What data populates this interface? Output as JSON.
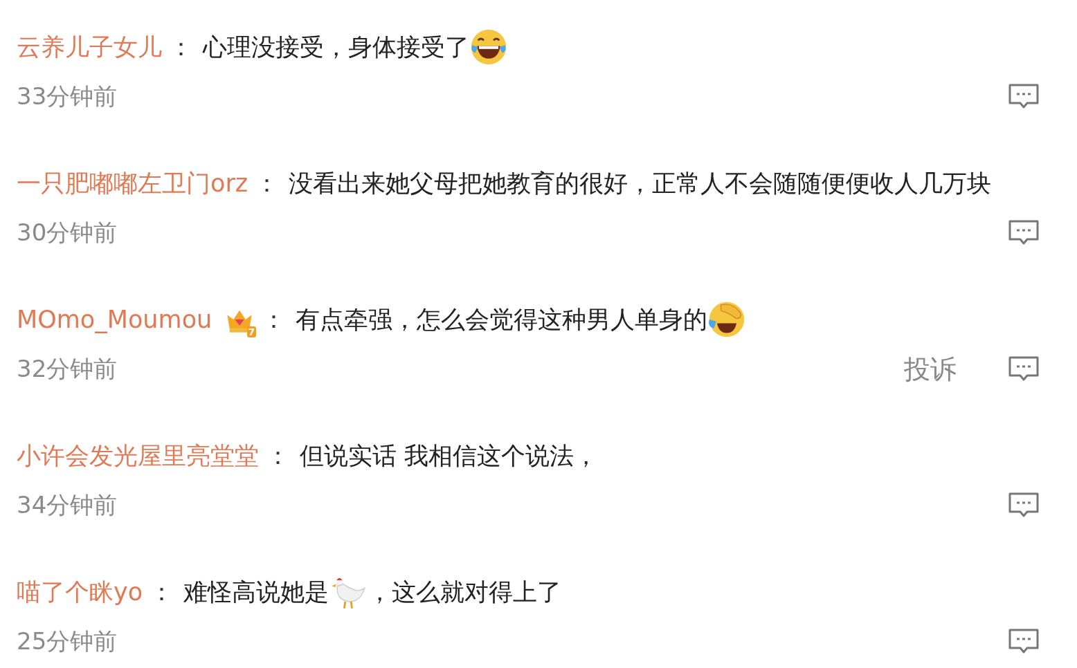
{
  "comments": [
    {
      "user": "云养儿子女儿",
      "colon": "：",
      "parts": [
        {
          "kind": "text",
          "text": "心理没接受，身体接受了"
        },
        {
          "kind": "laugh"
        }
      ],
      "time": "33分钟前"
    },
    {
      "user": "一只肥嘟嘟左卫门orz",
      "colon": "：",
      "parts": [
        {
          "kind": "text",
          "text": "没看出来她父母把她教育的很好，正常人不会随随便便收人几万块"
        }
      ],
      "time": "30分钟前"
    },
    {
      "user": "MOmo_Moumou",
      "badge": "7",
      "colon": "：",
      "parts": [
        {
          "kind": "text",
          "text": "有点牵强，怎么会觉得这种男人单身的"
        },
        {
          "kind": "facepalm"
        }
      ],
      "time": "32分钟前",
      "report": "投诉"
    },
    {
      "user": "小许会发光屋里亮堂堂",
      "colon": "：",
      "parts": [
        {
          "kind": "text",
          "text": "但说实话 我相信这个说法，"
        }
      ],
      "time": "34分钟前"
    },
    {
      "user": "喵了个眯yo",
      "colon": "：",
      "parts": [
        {
          "kind": "text",
          "text": "难怪高说她是"
        },
        {
          "kind": "rooster"
        },
        {
          "kind": "text",
          "text": "，这么就对得上了"
        }
      ],
      "time": "25分钟前"
    }
  ]
}
